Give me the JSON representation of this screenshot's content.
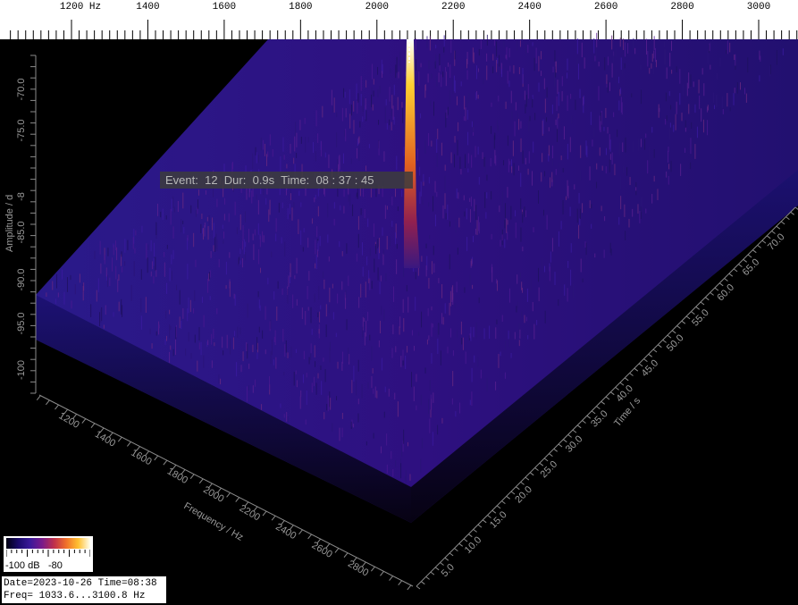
{
  "chart_data": {
    "type": "waterfall-3d",
    "freq_axis_top": {
      "unit_label": "Hz",
      "ticks": [
        "1200",
        "1400",
        "1600",
        "1800",
        "2000",
        "2200",
        "2400",
        "2600",
        "2800",
        "3000"
      ]
    },
    "freq_axis_bottom": {
      "label": "Frequency / Hz",
      "ticks": [
        "1200",
        "1400",
        "1600",
        "1800",
        "2000",
        "2200",
        "2400",
        "2600",
        "2800"
      ]
    },
    "amplitude_axis": {
      "label": "Amplitude / d",
      "ticks": [
        "-70.0",
        "-75.0",
        "-8",
        "-85.0",
        "-90.0",
        "-95.0",
        "-100"
      ],
      "ylim": [
        -100,
        -70
      ]
    },
    "time_axis": {
      "label": "Time / s",
      "ticks": [
        "5.0",
        "10.0",
        "15.0",
        "20.0",
        "25.0",
        "30.0",
        "35.0",
        "40.0",
        "45.0",
        "50.0",
        "55.0",
        "60.0",
        "65.0",
        "70.0"
      ]
    },
    "xlim": [
      1033.6,
      3100.8
    ],
    "peak": {
      "freq_hz": 2090,
      "amplitude_db": -70
    },
    "noise_floor_db": -88,
    "colorbar": {
      "min_label": "-100 dB",
      "mid_label": "-80"
    }
  },
  "event": {
    "label": "Event:",
    "number": "12",
    "dur_label": "Dur:",
    "dur": "0.9s",
    "time_label": "Time:",
    "time": "08 : 37 : 45"
  },
  "info": {
    "line1": "Date=2023-10-26 Time=08:38",
    "line2": "Freq= 1033.6...3100.8 Hz"
  }
}
